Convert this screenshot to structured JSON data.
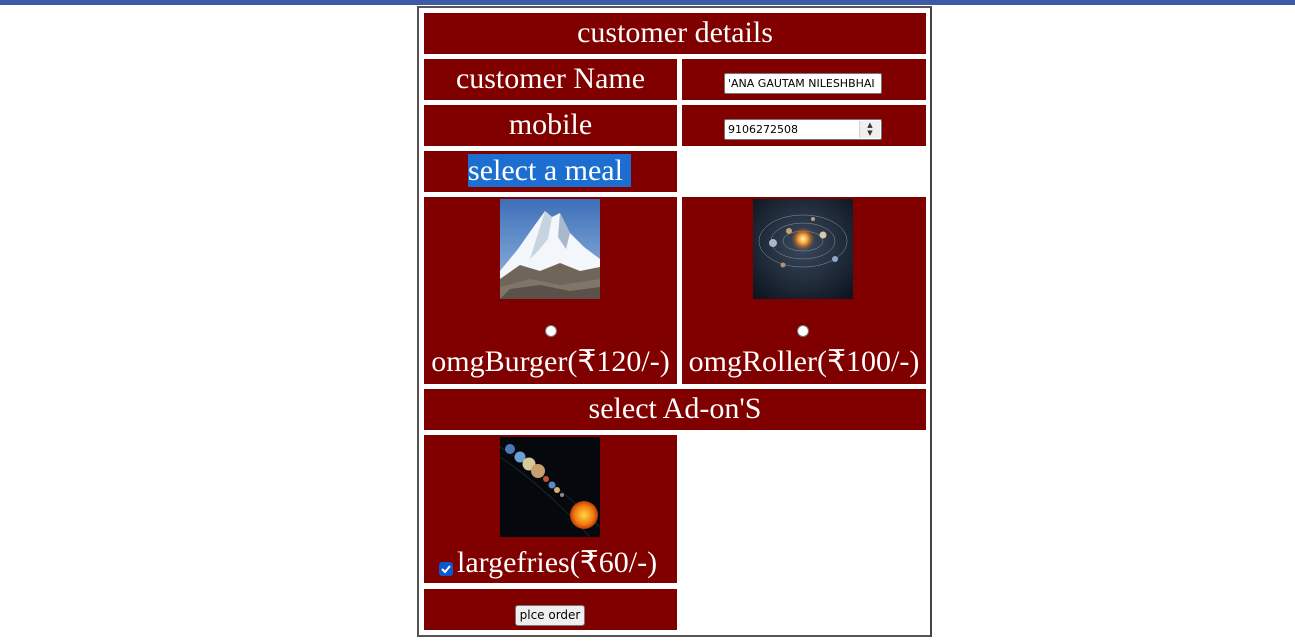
{
  "form": {
    "title": "customer details",
    "name_label": "customer Name",
    "name_value": "'ANA GAUTAM NILESHBHAI",
    "mobile_label": "mobile",
    "mobile_value": "9106272508",
    "meal_label": "select a meal",
    "meals": [
      {
        "label": "omgBurger(₹120/-)",
        "selected": false,
        "image": "mountain-photo"
      },
      {
        "label": "omgRoller(₹100/-)",
        "selected": false,
        "image": "solar-system-photo"
      }
    ],
    "addons_title": "select Ad-on'S",
    "addons": [
      {
        "label": "largefries(₹60/-)",
        "checked": true,
        "image": "planets-row-photo"
      }
    ],
    "submit_label": "plce order"
  },
  "colors": {
    "cell_background": "#800000",
    "text": "#ffffff",
    "selection_highlight": "#1c6fd1",
    "top_bar": "#3c5aa6",
    "checkbox_checked": "#0b57d0"
  }
}
